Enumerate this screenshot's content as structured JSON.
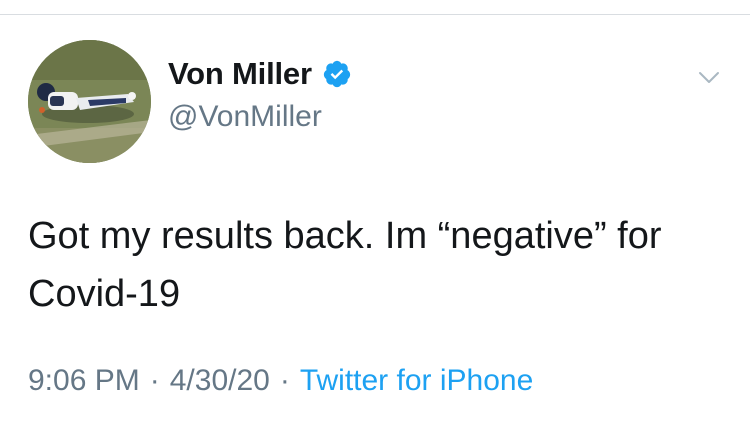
{
  "tweet": {
    "author": {
      "display_name": "Von Miller",
      "handle": "@VonMiller",
      "verified": true,
      "avatar_icon": "football-player-avatar"
    },
    "text": "Got my results back. Im “negative” for Covid-19",
    "meta": {
      "time": "9:06 PM",
      "date": "4/30/20",
      "separator": "·",
      "source": "Twitter for iPhone"
    }
  },
  "icons": {
    "verified": "verified-badge-icon",
    "more": "chevron-down-icon"
  },
  "colors": {
    "text_primary": "#14171a",
    "text_secondary": "#657786",
    "accent": "#1da1f2",
    "divider": "#d9dde1"
  }
}
